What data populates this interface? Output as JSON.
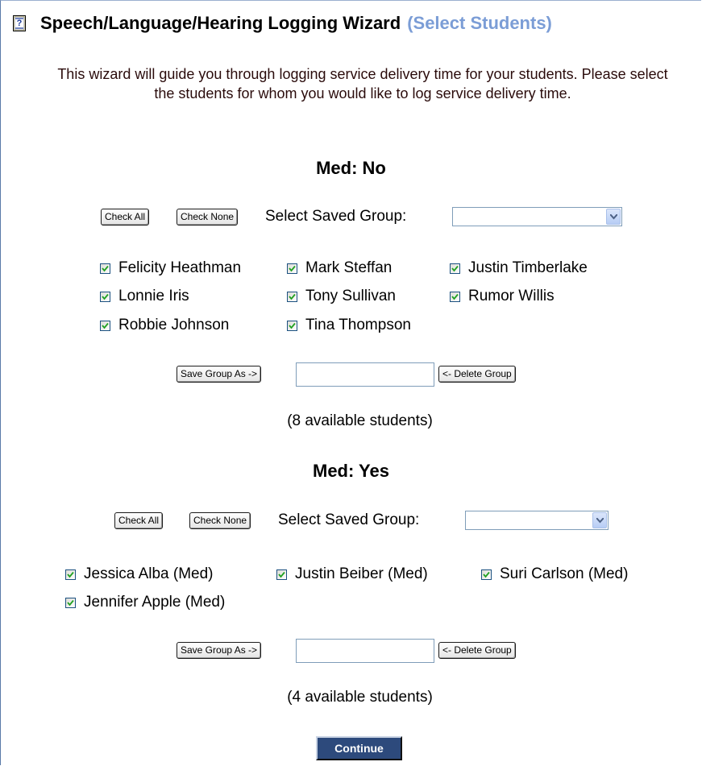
{
  "header": {
    "title": "Speech/Language/Hearing Logging Wizard",
    "subtitle": "(Select Students)",
    "icon": "help-book-icon"
  },
  "intro": "This wizard will guide you through logging service delivery time for your students. Please select the students for whom you would like to log service delivery time.",
  "groups": [
    {
      "title": "Med: No",
      "check_all": "Check All",
      "check_none": "Check None",
      "select_label": "Select Saved Group:",
      "select_value": "",
      "students": [
        {
          "name": "Felicity Heathman",
          "checked": true
        },
        {
          "name": "Mark Steffan",
          "checked": true
        },
        {
          "name": "Justin Timberlake",
          "checked": true
        },
        {
          "name": "Lonnie Iris",
          "checked": true
        },
        {
          "name": "Tony Sullivan",
          "checked": true
        },
        {
          "name": "Rumor Willis",
          "checked": true
        },
        {
          "name": "Robbie Johnson",
          "checked": true
        },
        {
          "name": "Tina Thompson",
          "checked": true
        }
      ],
      "save_group": "Save Group As ->",
      "group_name_value": "",
      "delete_group": "<- Delete Group",
      "count": "(8 available students)"
    },
    {
      "title": "Med: Yes",
      "check_all": "Check All",
      "check_none": "Check None",
      "select_label": "Select Saved Group:",
      "select_value": "",
      "students": [
        {
          "name": "Jessica Alba (Med)",
          "checked": true
        },
        {
          "name": "Justin Beiber (Med)",
          "checked": true
        },
        {
          "name": "Suri Carlson (Med)",
          "checked": true
        },
        {
          "name": "Jennifer Apple (Med)",
          "checked": true
        }
      ],
      "save_group": "Save Group As ->",
      "group_name_value": "",
      "delete_group": "<- Delete Group",
      "count": "(4 available students)"
    }
  ],
  "continue_label": "Continue"
}
